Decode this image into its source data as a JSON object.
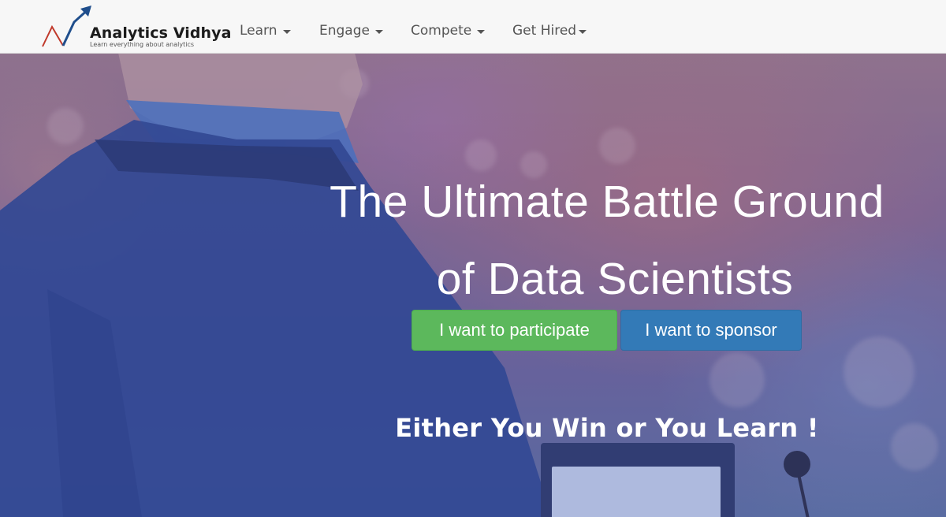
{
  "brand": {
    "name": "Analytics Vidhya",
    "tagline": "Learn everything about analytics",
    "logo_icon": "trend-arrow-logo",
    "colors": {
      "arrow": "#1f4e8c",
      "line": "#c0392b"
    }
  },
  "nav": {
    "items": [
      {
        "label": "Learn",
        "icon": "caret-down"
      },
      {
        "label": "Engage",
        "icon": "caret-down"
      },
      {
        "label": "Compete",
        "icon": "caret-down"
      },
      {
        "label": "Get Hired",
        "icon": "caret-down"
      }
    ]
  },
  "hero": {
    "title_line1": "The Ultimate Battle Ground",
    "title_line2": "of Data Scientists",
    "participate_label": "I want to participate",
    "sponsor_label": "I want to sponsor",
    "tagline": "Either You Win or You Learn !",
    "colors": {
      "participate": "#5cb85c",
      "sponsor": "#337ab7"
    }
  }
}
